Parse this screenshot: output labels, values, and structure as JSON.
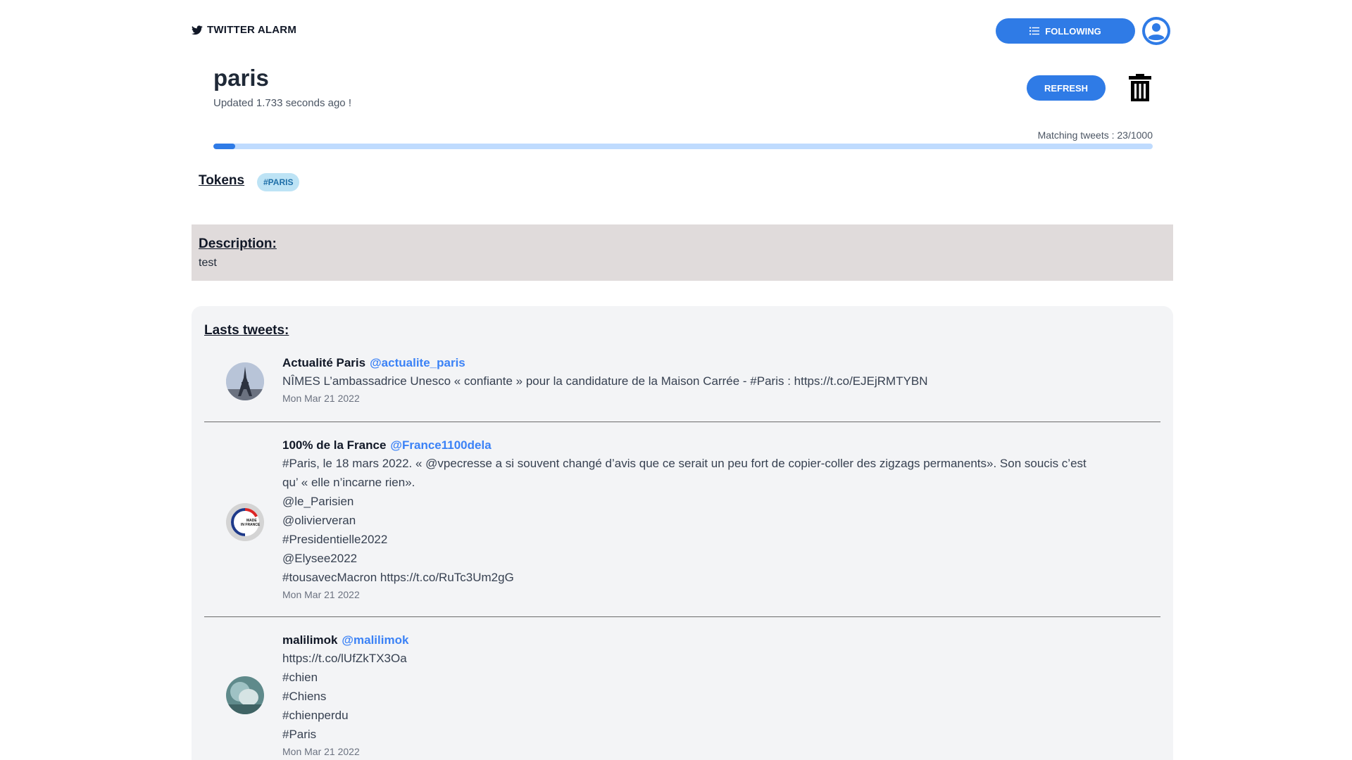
{
  "brand": {
    "label": "TWITTER ALARM"
  },
  "header": {
    "following_label": "FOLLOWING"
  },
  "alarm": {
    "title": "paris",
    "updated": "Updated 1.733 seconds ago !",
    "refresh_label": "REFRESH",
    "matching_label": "Matching tweets : 23/1000",
    "progress": {
      "current": 23,
      "total": 1000
    }
  },
  "tokens": {
    "label": "Tokens",
    "items": [
      "#PARIS"
    ]
  },
  "description": {
    "label": "Description:",
    "text": "test"
  },
  "tweets": {
    "label": "Lasts tweets:",
    "items": [
      {
        "name": "Actualité Paris",
        "handle": "@actualite_paris",
        "lines": [
          "NÎMES L’ambassadrice Unesco « confiante » pour la candidature de la Maison Carrée - #Paris : https://t.co/EJEjRMTYBN"
        ],
        "date": "Mon Mar 21 2022"
      },
      {
        "name": "100% de la France",
        "handle": "@France1100dela",
        "lines": [
          "#Paris, le 18 mars 2022. « @vpecresse a si souvent changé d’avis que ce serait un peu fort de copier-coller des zigzags permanents». Son soucis c’est",
          "qu’ « elle n’incarne rien».",
          "@le_Parisien",
          "@olivierveran",
          "#Presidentielle2022",
          "@Elysee2022",
          "#tousavecMacron https://t.co/RuTc3Um2gG"
        ],
        "date": "Mon Mar 21 2022",
        "avatar_text": "MADE IN FRANCE"
      },
      {
        "name": "malilimok",
        "handle": "@malilimok",
        "lines": [
          "https://t.co/lUfZkTX3Oa",
          "#chien",
          "#Chiens",
          "#chienperdu",
          "#Paris"
        ],
        "date": "Mon Mar 21 2022"
      }
    ]
  },
  "colors": {
    "accent": "#2f7be6",
    "progress_track": "#bfdbfe",
    "description_bg": "#e0dbdb",
    "handle": "#3b82f6"
  },
  "icons": [
    "twitter-bird-icon",
    "list-icon",
    "user-avatar-icon",
    "trash-icon"
  ]
}
